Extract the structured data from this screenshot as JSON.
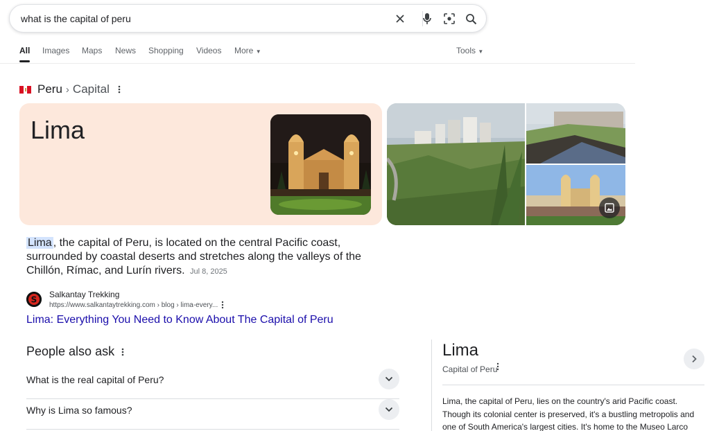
{
  "search": {
    "query": "what is the capital of peru",
    "icons": [
      "close-icon",
      "microphone-icon",
      "lens-icon",
      "search-icon"
    ]
  },
  "tabs": [
    {
      "label": "All",
      "active": true
    },
    {
      "label": "Images"
    },
    {
      "label": "Maps"
    },
    {
      "label": "News"
    },
    {
      "label": "Shopping"
    },
    {
      "label": "Videos"
    },
    {
      "label": "More"
    }
  ],
  "tools_label": "Tools",
  "breadcrumb": {
    "parent": "Peru",
    "separator": "›",
    "child": "Capital"
  },
  "hero": {
    "title": "Lima"
  },
  "snippet": {
    "highlight": "Lima",
    "text": ", the capital of Peru, is located on the central Pacific coast, surrounded by coastal deserts and stretches along the valleys of the Chillón, Rímac, and Lurín rivers.",
    "date": "Jul 8, 2025"
  },
  "source": {
    "name": "Salkantay Trekking",
    "url": "https://www.salkantaytrekking.com › blog › lima-every...",
    "favicon_letter": "S"
  },
  "result_link": "Lima: Everything You Need to Know About The Capital of Peru",
  "paa": {
    "title": "People also ask",
    "questions": [
      "What is the real capital of Peru?",
      "Why is Lima so famous?"
    ]
  },
  "knowledge_panel": {
    "title": "Lima",
    "subtitle": "Capital of Peru",
    "description": "Lima, the capital of Peru, lies on the country's arid Pacific coast. Though its colonial center is preserved, it's a bustling metropolis and one of South America's largest cities. It's home to the Museo Larco"
  },
  "colors": {
    "link": "#1a0dab",
    "hero_bg": "#fde8dc",
    "highlight": "#d3e3fd"
  }
}
